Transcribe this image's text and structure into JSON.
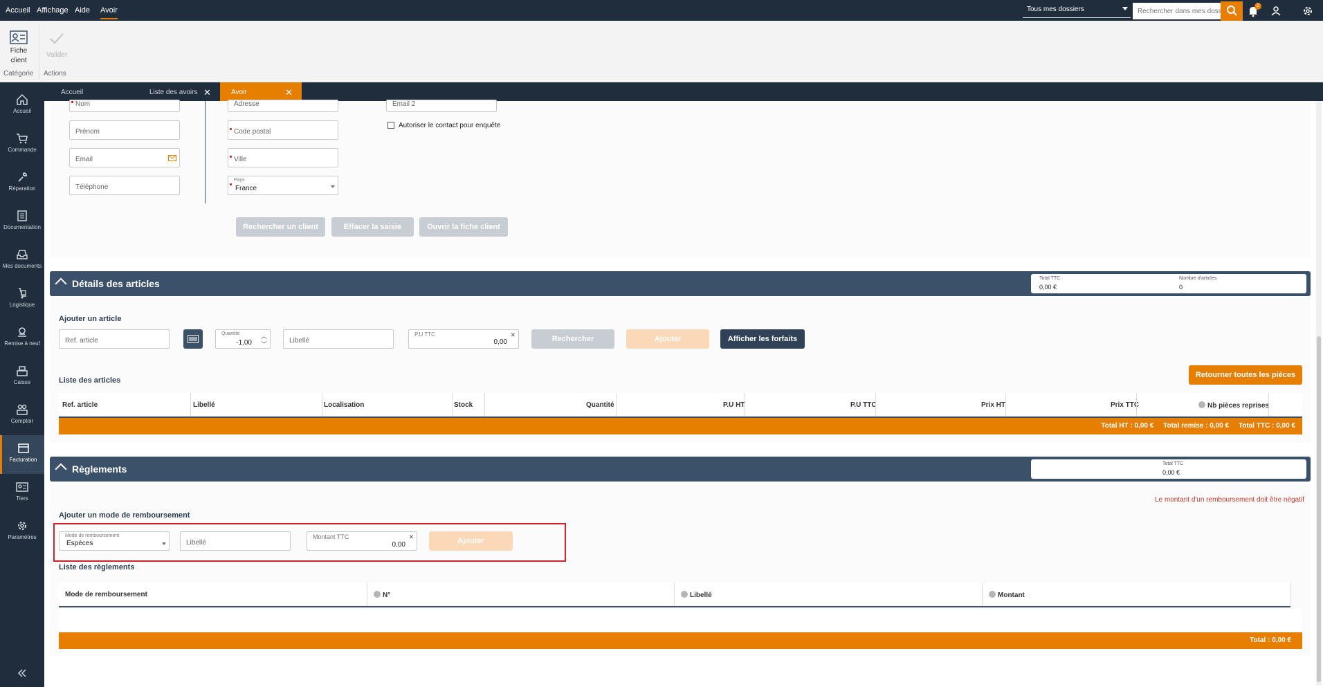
{
  "topbar": {
    "menus": [
      "Accueil",
      "Affichage",
      "Aide",
      "Avoir"
    ],
    "folder_select": "Tous mes dossiers",
    "search_placeholder": "Rechercher dans mes dossiers",
    "notification_count": "2",
    "accent": "#e67e00",
    "background": "#1f2d3d"
  },
  "ribbon": {
    "fiche_client_line1": "Fiche",
    "fiche_client_line2": "client",
    "valider": "Valider",
    "group_categorie": "Catégorie",
    "group_actions": "Actions"
  },
  "tabs": [
    {
      "label": "Accueil"
    },
    {
      "label": "Liste des avoirs"
    },
    {
      "label": "Avoir"
    }
  ],
  "sidebar": [
    {
      "label": "Accueil",
      "icon": "home-icon"
    },
    {
      "label": "Commande",
      "icon": "cart-icon"
    },
    {
      "label": "Réparation",
      "icon": "wrench-icon"
    },
    {
      "label": "Documentation",
      "icon": "document-icon"
    },
    {
      "label": "Mes documents",
      "icon": "inbox-icon"
    },
    {
      "label": "Logistique",
      "icon": "dolly-icon"
    },
    {
      "label": "Remise à neuf",
      "icon": "refurbish-icon"
    },
    {
      "label": "Caisse",
      "icon": "cash-register-icon"
    },
    {
      "label": "Comptoir",
      "icon": "counter-icon"
    },
    {
      "label": "Facturation",
      "icon": "invoice-icon"
    },
    {
      "label": "Tiers",
      "icon": "contact-card-icon"
    },
    {
      "label": "Paramètres",
      "icon": "gear-icon"
    }
  ],
  "client": {
    "nom": "Nom",
    "prenom": "Prénom",
    "email": "Email",
    "telephone": "Téléphone",
    "adresse": "Adresse",
    "code_postal": "Code postal",
    "ville": "Ville",
    "pays_label": "Pays",
    "pays_value": "France",
    "email2": "Email 2",
    "autoriser": "Autoriser le contact pour enquête",
    "btn_rechercher": "Rechercher un client",
    "btn_effacer": "Effacer la saisie",
    "btn_ouvrir": "Ouvrir la fiche client"
  },
  "articles": {
    "title": "Détails des articles",
    "total_ttc_label": "Total TTC",
    "total_ttc_value": "0,00 €",
    "nb_articles_label": "Nombre d'articles",
    "nb_articles_value": "0",
    "ajouter_title": "Ajouter un article",
    "ref_placeholder": "Ref. article",
    "quantite_label": "Quantité",
    "quantite_value": "-1,00",
    "libelle_placeholder": "Libellé",
    "pu_ttc_label": "P.U TTC",
    "pu_ttc_value": "0,00",
    "btn_rechercher": "Rechercher",
    "btn_ajouter": "Ajouter",
    "btn_forfaits": "Afficher les forfaits",
    "btn_retourner": "Retourner toutes les pièces",
    "liste_title": "Liste des articles",
    "columns": [
      "Ref. article",
      "Libellé",
      "Localisation",
      "Stock",
      "Quantité",
      "P.U HT",
      "P.U TTC",
      "Prix HT",
      "Prix TTC",
      "Nb pièces reprises"
    ],
    "totals": "Total HT : 0,00 €     Total remise : 0,00 €     Total TTC : 0,00 €"
  },
  "reglements": {
    "title": "Règlements",
    "total_ttc_label": "Total TTC",
    "total_ttc_value": "0,00 €",
    "warning": "Le montant d'un remboursement doit être négatif",
    "ajouter_title": "Ajouter un mode de remboursement",
    "mode_label": "Mode de remboursement",
    "mode_value": "Espèces",
    "libelle_placeholder": "Libellé",
    "montant_label": "Montant TTC",
    "montant_value": "0,00",
    "btn_ajouter": "Ajouter",
    "liste_title": "Liste des règlements",
    "columns": [
      "Mode de remboursement",
      "N°",
      "Libellé",
      "Montant"
    ],
    "total": "Total : 0,00 €"
  }
}
